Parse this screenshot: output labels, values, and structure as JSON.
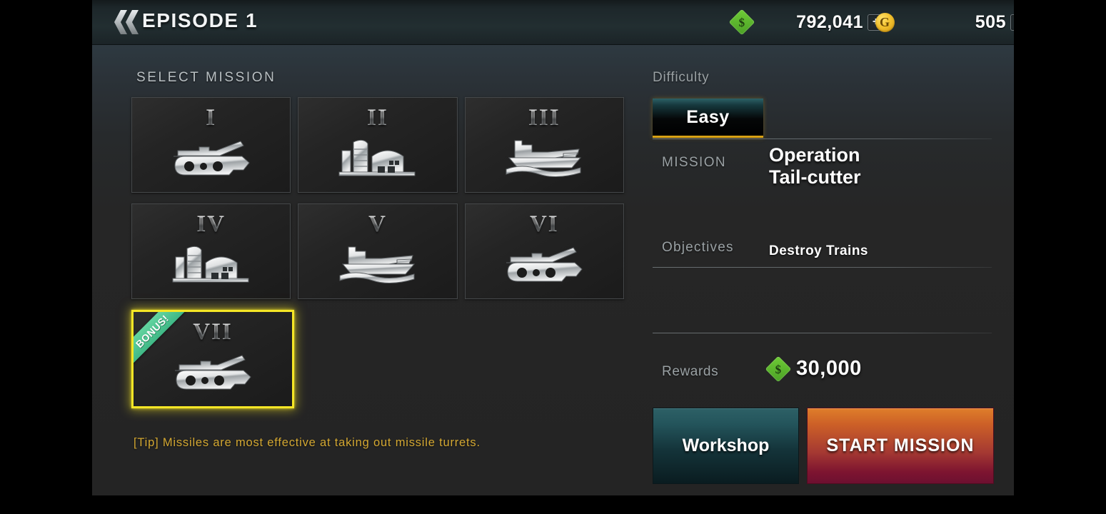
{
  "header": {
    "back_icon": "double-chevron-left-icon",
    "title": "EPISODE 1",
    "cash": {
      "icon": "green-diamond-dollar-icon",
      "icon_glyph": "$",
      "value": "792,041",
      "plus_label": "+",
      "color": "#5ab22c"
    },
    "gold": {
      "icon": "gold-coin-icon",
      "icon_glyph": "G",
      "value": "505",
      "plus_label": "+",
      "color": "#f2c12e"
    }
  },
  "mission_select": {
    "heading": "SELECT MISSION",
    "tiles": [
      {
        "numeral": "I",
        "icon": "tank-icon",
        "selected": false,
        "bonus": false,
        "bonus_label": ""
      },
      {
        "numeral": "II",
        "icon": "factory-icon",
        "selected": false,
        "bonus": false,
        "bonus_label": ""
      },
      {
        "numeral": "III",
        "icon": "ship-icon",
        "selected": false,
        "bonus": false,
        "bonus_label": ""
      },
      {
        "numeral": "IV",
        "icon": "factory-icon",
        "selected": false,
        "bonus": false,
        "bonus_label": ""
      },
      {
        "numeral": "V",
        "icon": "ship-icon",
        "selected": false,
        "bonus": false,
        "bonus_label": ""
      },
      {
        "numeral": "VI",
        "icon": "tank-icon",
        "selected": false,
        "bonus": false,
        "bonus_label": ""
      },
      {
        "numeral": "VII",
        "icon": "tank-icon",
        "selected": true,
        "bonus": true,
        "bonus_label": "BONUS!"
      }
    ],
    "tip": "[Tip] Missiles are most effective at taking out missile turrets."
  },
  "info_panel": {
    "difficulty_label": "Difficulty",
    "difficulty_selected": "Easy",
    "mission_label": "MISSION",
    "mission_name": "Operation\nTail-cutter",
    "mission_name_line1": "Operation",
    "mission_name_line2": "Tail-cutter",
    "objectives_label": "Objectives",
    "objectives_value": "Destroy Trains",
    "rewards_label": "Rewards",
    "rewards_icon": "green-diamond-dollar-icon",
    "rewards_icon_glyph": "$",
    "rewards_value": "30,000",
    "workshop_button": "Workshop",
    "start_button": "START MISSION"
  },
  "theme": {
    "selected_tile_border": "#f5e626",
    "bonus_ribbon": "#4fc98e",
    "tip_color": "#d4a832",
    "difficulty_underline": "#d9a215",
    "start_button_top": "#df7e2a",
    "start_button_bottom": "#6d1030",
    "workshop_button_top": "#2d6066"
  }
}
